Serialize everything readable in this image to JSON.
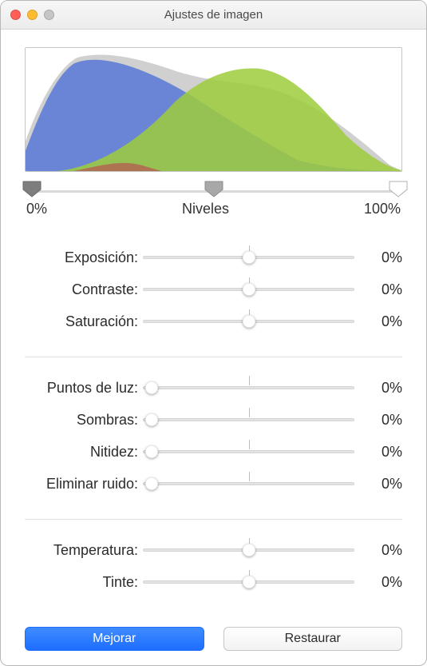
{
  "window": {
    "title": "Ajustes de imagen"
  },
  "levels": {
    "left": "0%",
    "center": "Niveles",
    "right": "100%",
    "handles": {
      "shadows": 2,
      "mid": 50,
      "highlights": 99
    }
  },
  "groups": [
    {
      "rows": [
        {
          "label": "Exposición:",
          "value": "0%",
          "knob": 50,
          "tick": true
        },
        {
          "label": "Contraste:",
          "value": "0%",
          "knob": 50,
          "tick": true
        },
        {
          "label": "Saturación:",
          "value": "0%",
          "knob": 50,
          "tick": true
        }
      ]
    },
    {
      "rows": [
        {
          "label": "Puntos de luz:",
          "value": "0%",
          "knob": 4,
          "tick": true
        },
        {
          "label": "Sombras:",
          "value": "0%",
          "knob": 4,
          "tick": true
        },
        {
          "label": "Nitidez:",
          "value": "0%",
          "knob": 4,
          "tick": true
        },
        {
          "label": "Eliminar ruido:",
          "value": "0%",
          "knob": 4,
          "tick": true
        }
      ]
    },
    {
      "rows": [
        {
          "label": "Temperatura:",
          "value": "0%",
          "knob": 50,
          "tick": true
        },
        {
          "label": "Tinte:",
          "value": "0%",
          "knob": 50,
          "tick": true
        }
      ]
    }
  ],
  "buttons": {
    "enhance": "Mejorar",
    "reset": "Restaurar"
  },
  "colors": {
    "accent": "#1e6dff"
  }
}
